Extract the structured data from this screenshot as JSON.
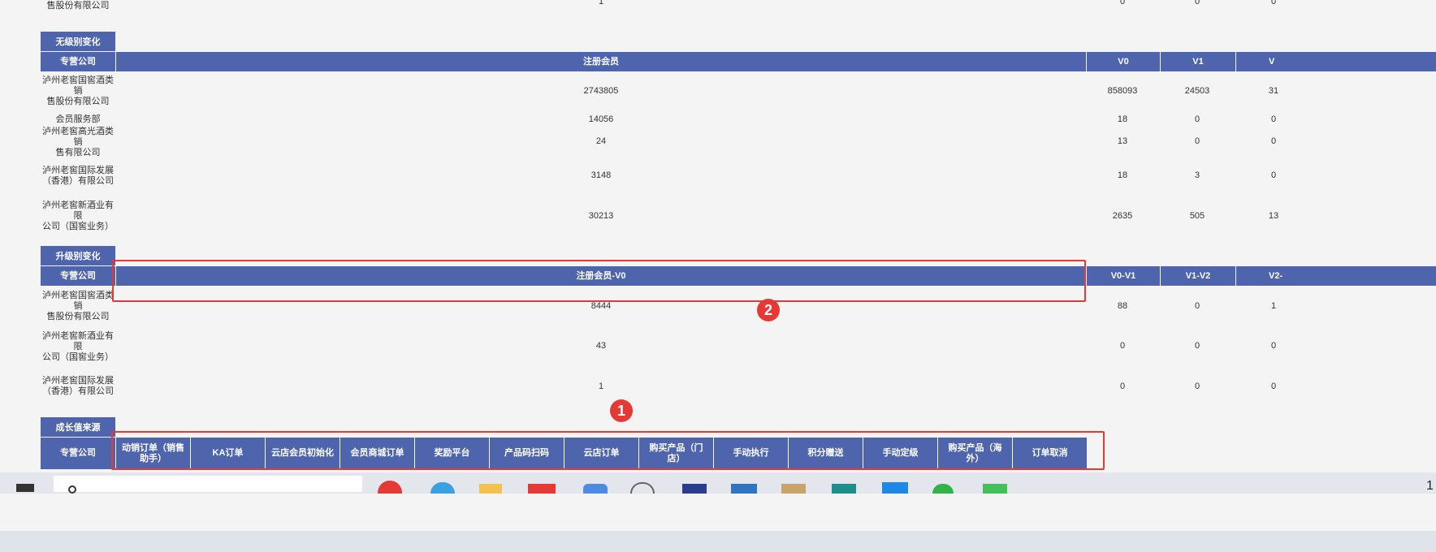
{
  "top_partial": {
    "company_lines": [
      "售股份有限公司"
    ],
    "values": [
      "1",
      "0",
      "0",
      "0"
    ]
  },
  "no_level_change": {
    "section_label": "无级别变化",
    "headers": [
      "专营公司",
      "注册会员",
      "V0",
      "V1",
      "V"
    ],
    "rows": [
      {
        "company": [
          "泸州老窖国窖酒类销",
          "售股份有限公司"
        ],
        "registered": "2743805",
        "v0": "858093",
        "v1": "24503",
        "v2": "31"
      },
      {
        "company": [
          "会员服务部"
        ],
        "registered": "14056",
        "v0": "18",
        "v1": "0",
        "v2": "0"
      },
      {
        "company": [
          "泸州老窖高光酒类销",
          "售有限公司"
        ],
        "registered": "24",
        "v0": "13",
        "v1": "0",
        "v2": "0"
      },
      {
        "company": [
          "泸州老窖国际发展",
          "（香港）有限公司"
        ],
        "registered": "3148",
        "v0": "18",
        "v1": "3",
        "v2": "0"
      },
      {
        "company": [
          "泸州老窖新酒业有限",
          "公司（国窖业务）"
        ],
        "registered": "30213",
        "v0": "2635",
        "v1": "505",
        "v2": "13"
      }
    ]
  },
  "upgrade_change": {
    "section_label": "升级别变化",
    "headers": [
      "专营公司",
      "注册会员-V0",
      "V0-V1",
      "V1-V2",
      "V2-"
    ],
    "rows": [
      {
        "company": [
          "泸州老窖国窖酒类销",
          "售股份有限公司"
        ],
        "registered": "8444",
        "v0": "88",
        "v1": "0",
        "v2": "1"
      },
      {
        "company": [
          "泸州老窖新酒业有限",
          "公司（国窖业务）"
        ],
        "registered": "43",
        "v0": "0",
        "v1": "0",
        "v2": "0"
      },
      {
        "company": [
          "泸州老窖国际发展",
          "（香港）有限公司"
        ],
        "registered": "1",
        "v0": "0",
        "v1": "0",
        "v2": "0"
      }
    ]
  },
  "growth_source": {
    "section_label": "成长值来源",
    "first_header": "专营公司",
    "headers": [
      "动销订单（销售助手）",
      "KA订单",
      "云店会员初始化",
      "会员商城订单",
      "奖励平台",
      "产品码扫码",
      "云店订单",
      "购买产品（门店）",
      "手动执行",
      "积分赠送",
      "手动定级",
      "购买产品（海外）",
      "订单取消"
    ]
  },
  "annotations": {
    "badge_1": "1",
    "badge_2": "2",
    "color": "#e53935"
  },
  "colors": {
    "header_bg": "#4e65ad",
    "page_bg": "#f4f4f4"
  },
  "taskbar": {
    "search_icon": "search-icon",
    "right_text": "1"
  }
}
